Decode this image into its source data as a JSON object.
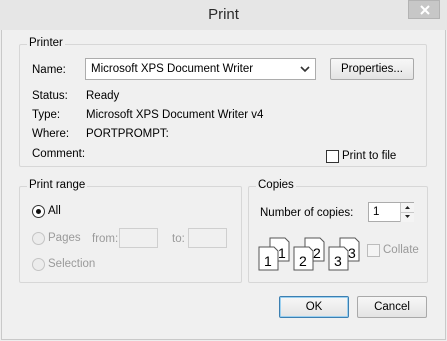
{
  "window": {
    "title": "Print"
  },
  "printer": {
    "group_label": "Printer",
    "name_label": "Name:",
    "name_value": "Microsoft XPS Document Writer",
    "properties_button": "Properties...",
    "status_label": "Status:",
    "status_value": "Ready",
    "type_label": "Type:",
    "type_value": "Microsoft XPS Document Writer v4",
    "where_label": "Where:",
    "where_value": "PORTPROMPT:",
    "comment_label": "Comment:",
    "print_to_file_label": "Print to file",
    "print_to_file_checked": false
  },
  "print_range": {
    "group_label": "Print range",
    "all_label": "All",
    "pages_label": "Pages",
    "from_label": "from:",
    "to_label": "to:",
    "selection_label": "Selection",
    "selected": "All"
  },
  "copies": {
    "group_label": "Copies",
    "number_label": "Number of copies:",
    "number_value": "1",
    "collate_label": "Collate",
    "collate_checked": false,
    "collate_icon_digits": [
      "1",
      "1",
      "2",
      "2",
      "3",
      "3"
    ]
  },
  "buttons": {
    "ok": "OK",
    "cancel": "Cancel"
  },
  "icons": {
    "close": "close-icon",
    "dropdown": "chevron-down-icon",
    "spin_up": "spin-up-icon",
    "spin_down": "spin-down-icon",
    "collate": "collate-pages-icon"
  }
}
